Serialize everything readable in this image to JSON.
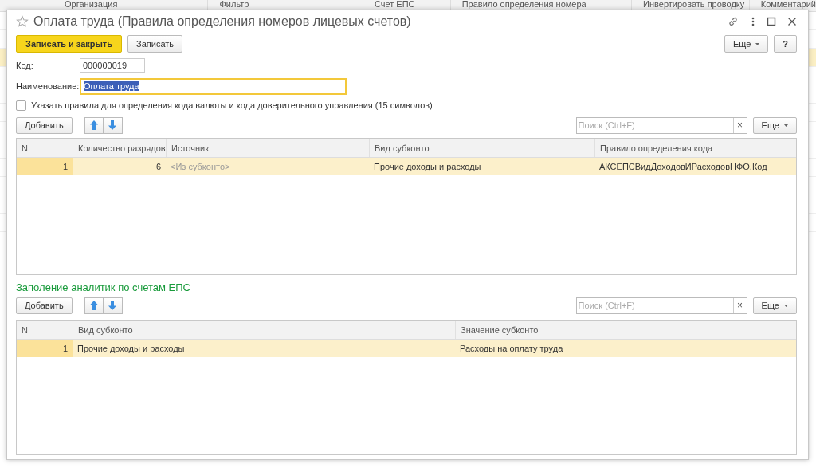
{
  "background_list": {
    "columns": [
      "Организация",
      "Фильтр",
      "Счет ЕПС",
      "Правило определения номера",
      "Инвертировать проводку",
      "Комментарий"
    ]
  },
  "window": {
    "title": "Оплата труда (Правила определения номеров лицевых счетов)"
  },
  "command_bar": {
    "buttons": [
      {
        "label": "Записать и закрыть",
        "kind": "default"
      },
      {
        "label": "Записать",
        "kind": "plain"
      }
    ],
    "more": "Еще",
    "help": "?"
  },
  "fields": [
    {
      "label": "Код:",
      "value": "000000019",
      "focused": false
    },
    {
      "label": "Наименование:",
      "value": "Оплата труда",
      "focused": true
    }
  ],
  "checkbox": {
    "label": "Указать правила для определения кода валюты и кода доверительного управления (15 символов)",
    "checked": false
  },
  "tables": [
    {
      "add": "Добавить",
      "search": {
        "placeholder": "Поиск (Ctrl+F)",
        "clear": "×"
      },
      "more": "Еще",
      "columns": [
        "N",
        "Количество разрядов",
        "Источник",
        "Вид субконто",
        "Правило определения кода"
      ],
      "rows": [
        {
          "selected": true,
          "cells": [
            "1",
            "6",
            "<Из субконто>",
            "Прочие доходы и расходы",
            "АКСЕПСВидДоходовИРасходовНФО.Код"
          ]
        }
      ]
    },
    {
      "title": "Заполение аналитик по счетам ЕПС",
      "add": "Добавить",
      "search": {
        "placeholder": "Поиск (Ctrl+F)",
        "clear": "×"
      },
      "more": "Еще",
      "columns": [
        "N",
        "Вид субконто",
        "Значение субконто"
      ],
      "rows": [
        {
          "selected": true,
          "cells": [
            "1",
            "Прочие доходы и расходы",
            "Расходы на оплату труда"
          ]
        }
      ]
    }
  ]
}
